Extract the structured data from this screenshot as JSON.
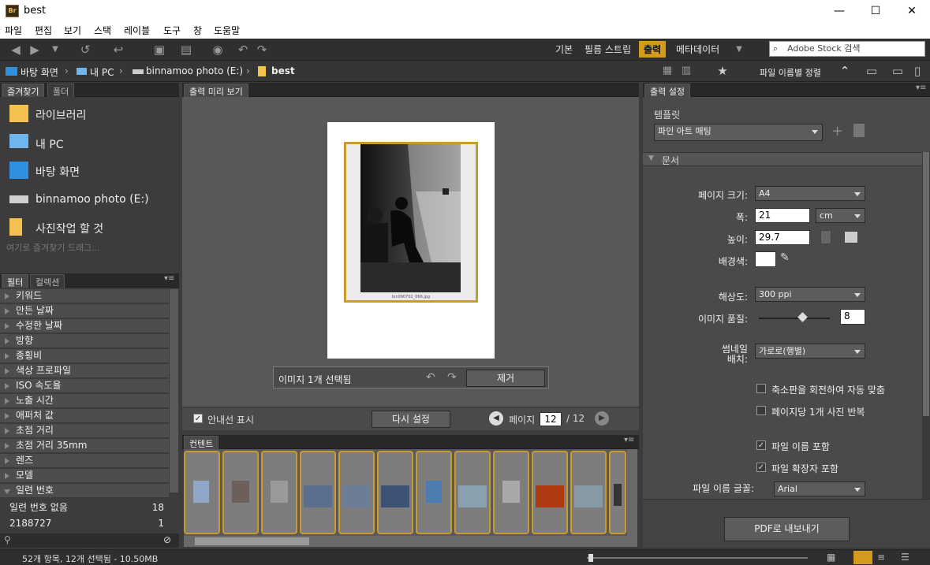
{
  "window": {
    "app_logo": "Br",
    "title": "best",
    "minimize": "—",
    "maximize": "☐",
    "close": "✕"
  },
  "menu": [
    "파일",
    "편집",
    "보기",
    "스택",
    "레이블",
    "도구",
    "창",
    "도움말"
  ],
  "workspaces": {
    "basic": "기본",
    "filmstrip": "필름 스트립",
    "output": "출력",
    "metadata": "메타데이터"
  },
  "search": {
    "placeholder": "Adobe Stock 검색"
  },
  "breadcrumb": [
    "바탕 화면",
    "내 PC",
    "binnamoo photo (E:)",
    "best"
  ],
  "sort": {
    "label": "파일 이름별 정렬"
  },
  "favorites": {
    "tabs": [
      "즐겨찾기",
      "폴더"
    ],
    "items": [
      "라이브러리",
      "내 PC",
      "바탕 화면",
      "binnamoo photo (E:)",
      "사진작업 할 것"
    ],
    "hint": "여기로 즐겨찾기 드래그..."
  },
  "filter": {
    "tabs": [
      "필터",
      "컬렉션"
    ],
    "rows": [
      "키워드",
      "만든 날짜",
      "수정한 날짜",
      "방향",
      "종횡비",
      "색상 프로파일",
      "ISO 속도율",
      "노출 시간",
      "애퍼처 값",
      "초점 거리",
      "초점 거리 35mm",
      "렌즈",
      "모델",
      "일련 번호"
    ],
    "sub": [
      {
        "label": "일련 번호 없음",
        "count": "18"
      },
      {
        "label": "2188727",
        "count": "1"
      }
    ]
  },
  "preview": {
    "tab": "출력 미리 보기",
    "caption": "bin090702_066.jpg",
    "selection": "이미지 1개 선택됨",
    "remove": "제거",
    "guides": "안내선 표시",
    "reset": "다시 설정",
    "page_label": "페이지",
    "page": "12",
    "total": "/ 12"
  },
  "content": {
    "tab": "컨텐트"
  },
  "settings": {
    "tab": "출력 설정",
    "template_label": "템플릿",
    "template_value": "파인 아트 매팅",
    "section_doc": "문서",
    "page_size_label": "페이지 크기:",
    "page_size": "A4",
    "width_label": "폭:",
    "width": "21",
    "unit": "cm",
    "height_label": "높이:",
    "height": "29.7",
    "bg_label": "배경색:",
    "res_label": "해상도:",
    "resolution": "300 ppi",
    "quality_label": "이미지 품질:",
    "quality": "8",
    "thumb_label_1": "썸네일",
    "thumb_label_2": "배치:",
    "thumb_layout": "가로로(행별)",
    "cb_rotate": "축소판을 회전하여 자동 맞춤",
    "cb_repeat": "페이지당 1개 사진 반복",
    "cb_filename": "파일 이름 포함",
    "cb_ext": "파일 확장자 포함",
    "font_label": "파일 이름 글꼴:",
    "font": "Arial",
    "export": "PDF로 내보내기"
  },
  "status": {
    "text": "52개 항목, 12개 선택됨 - 10.50MB"
  }
}
